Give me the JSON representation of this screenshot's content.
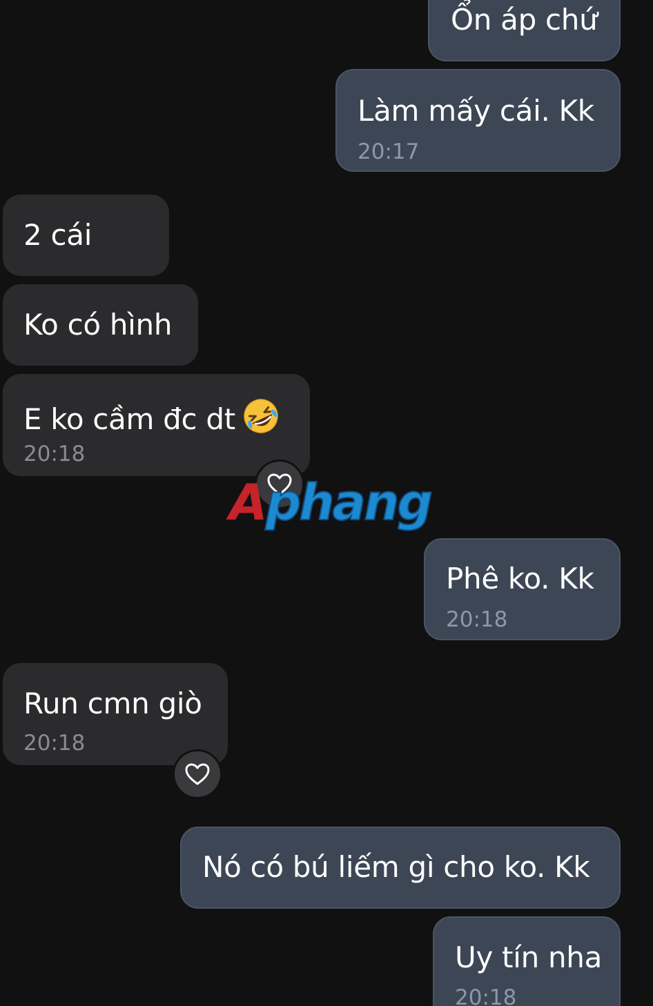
{
  "messages": [
    {
      "id": "m1",
      "direction": "sent",
      "text": "Ổn áp chứ",
      "time": ""
    },
    {
      "id": "m2",
      "direction": "sent",
      "text": "Làm mấy cái. Kk",
      "time": "20:17"
    },
    {
      "id": "m3",
      "direction": "received",
      "text": "2 cái",
      "time": ""
    },
    {
      "id": "m4",
      "direction": "received",
      "text": "Ko có hình",
      "time": ""
    },
    {
      "id": "m5",
      "direction": "received",
      "text": "E ko cầm đc dt",
      "time": "20:18",
      "emoji": "rolling-on-floor-laughing"
    },
    {
      "id": "m6",
      "direction": "sent",
      "text": "Phê ko. Kk",
      "time": "20:18"
    },
    {
      "id": "m7",
      "direction": "received",
      "text": "Run cmn giò",
      "time": "20:18"
    },
    {
      "id": "m8",
      "direction": "sent",
      "text": "Nó có bú liếm gì cho ko. Kk",
      "time": ""
    },
    {
      "id": "m9",
      "direction": "sent",
      "text": "Uy tín nha",
      "time": "20:18"
    }
  ],
  "reaction_icon": "heart-outline-icon",
  "watermark": {
    "first": "A",
    "rest": "phang"
  },
  "colors": {
    "background": "#111112",
    "sent_bubble": "#3d4654",
    "received_bubble": "#2b2b2d",
    "text": "#ffffff",
    "watermark_red": "#c6232a",
    "watermark_blue": "#1d8ad0"
  }
}
